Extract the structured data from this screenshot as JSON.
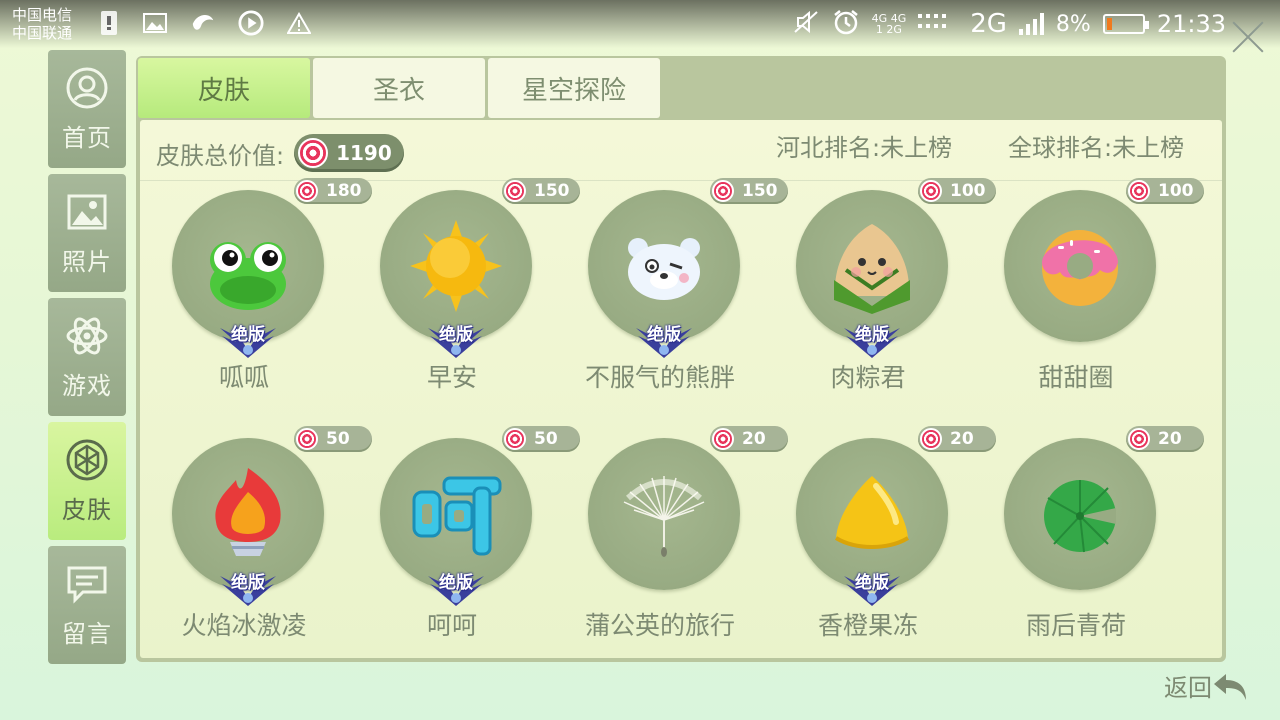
{
  "status_bar": {
    "carrier_1": "中国电信",
    "carrier_2": "中国联通",
    "network_small_top": "4G 4G",
    "network_small_bottom": "1 2G",
    "network_type": "2G",
    "battery_percent": "8%",
    "battery_level": 0.08,
    "time": "21:33"
  },
  "sidebar": {
    "items": [
      {
        "label": "首页",
        "icon": "user-circle-icon",
        "active": false
      },
      {
        "label": "照片",
        "icon": "image-icon",
        "active": false
      },
      {
        "label": "游戏",
        "icon": "atom-icon",
        "active": false
      },
      {
        "label": "皮肤",
        "icon": "gem-icon",
        "active": true
      },
      {
        "label": "留言",
        "icon": "message-icon",
        "active": false
      }
    ]
  },
  "tabs": [
    {
      "label": "皮肤",
      "active": true
    },
    {
      "label": "圣衣",
      "active": false
    },
    {
      "label": "星空探险",
      "active": false
    }
  ],
  "summary": {
    "total_label": "皮肤总价值:",
    "total_value": "1190",
    "province_rank": "河北排名:未上榜",
    "global_rank": "全球排名:未上榜"
  },
  "skins": [
    {
      "name": "呱呱",
      "price": "180",
      "badge": "绝版",
      "art": "frog-icon"
    },
    {
      "name": "早安",
      "price": "150",
      "badge": "绝版",
      "art": "sun-icon"
    },
    {
      "name": "不服气的熊胖",
      "price": "150",
      "badge": "绝版",
      "art": "bear-icon"
    },
    {
      "name": "肉粽君",
      "price": "100",
      "badge": "绝版",
      "art": "zongzi-icon"
    },
    {
      "name": "甜甜圈",
      "price": "100",
      "badge": "",
      "art": "donut-icon"
    },
    {
      "name": "火焰冰激凌",
      "price": "50",
      "badge": "绝版",
      "art": "flame-icecream-icon"
    },
    {
      "name": "呵呵",
      "price": "50",
      "badge": "绝版",
      "art": "hehe-text-icon"
    },
    {
      "name": "蒲公英的旅行",
      "price": "20",
      "badge": "",
      "art": "dandelion-icon"
    },
    {
      "name": "香橙果冻",
      "price": "20",
      "badge": "绝版",
      "art": "jelly-icon"
    },
    {
      "name": "雨后青荷",
      "price": "20",
      "badge": "",
      "art": "lotus-leaf-icon"
    }
  ],
  "footer": {
    "back_label": "返回"
  },
  "colors": {
    "accent_green": "#b6ea7c",
    "muted_text": "#7d8a72",
    "circle_bg": "#98ab83",
    "candy_red": "#e8345c"
  }
}
